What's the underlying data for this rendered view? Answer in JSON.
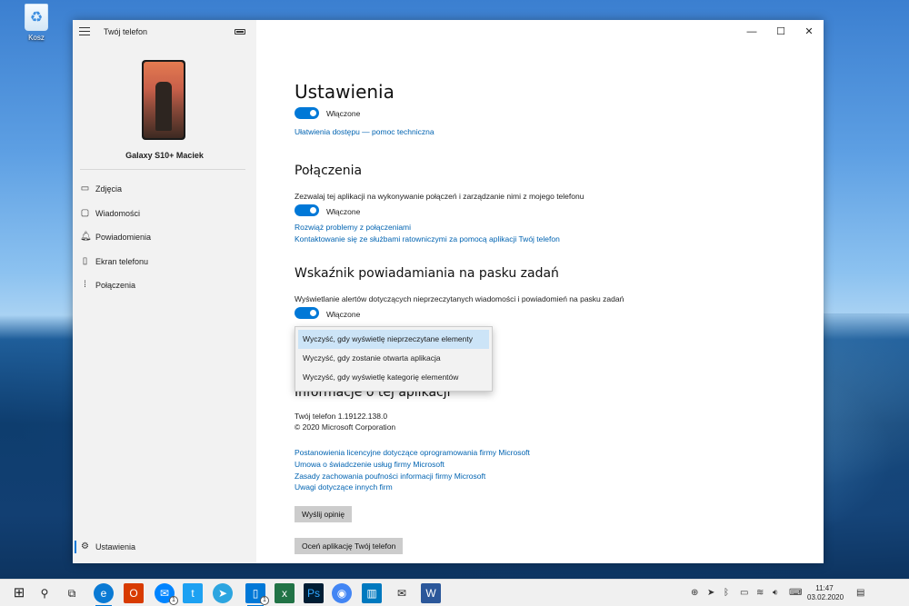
{
  "desktop": {
    "recycle_label": "Kosz"
  },
  "window": {
    "app_title": "Twój telefon",
    "minimize": "—",
    "maximize": "☐",
    "close": "✕"
  },
  "sidebar": {
    "device_name": "Galaxy S10+ Maciek",
    "items": [
      {
        "label": "Zdjęcia",
        "icon": "photos-icon"
      },
      {
        "label": "Wiadomości",
        "icon": "messages-icon"
      },
      {
        "label": "Powiadomienia",
        "icon": "bell-icon"
      },
      {
        "label": "Ekran telefonu",
        "icon": "phone-screen-icon"
      },
      {
        "label": "Połączenia",
        "icon": "dialpad-icon"
      }
    ],
    "settings_label": "Ustawienia"
  },
  "main": {
    "title": "Ustawienia",
    "toggle1_label": "Włączone",
    "accessibility_link": "Ułatwienia dostępu — pomoc techniczna",
    "calls": {
      "heading": "Połączenia",
      "description": "Zezwalaj tej aplikacji na wykonywanie połączeń i zarządzanie nimi z mojego telefonu",
      "toggle_label": "Włączone",
      "link1": "Rozwiąż problemy z połączeniami",
      "link2": "Kontaktowanie się ze służbami ratowniczymi za pomocą aplikacji Twój telefon"
    },
    "badge_section": {
      "heading": "Wskaźnik powiadamiania na pasku zadań",
      "description": "Wyświetlanie alertów dotyczących nieprzeczytanych wiadomości i powiadomień na pasku zadań",
      "toggle_label": "Włączone",
      "options": [
        "Wyczyść, gdy wyświetlę nieprzeczytane elementy",
        "Wyczyść, gdy zostanie otwarta aplikacja",
        "Wyczyść, gdy wyświetlę kategorię elementów"
      ],
      "selected_index": 0
    },
    "about": {
      "heading": "Informacje o tej aplikacji",
      "version": "Twój telefon 1.19122.138.0",
      "copyright": "© 2020 Microsoft Corporation",
      "links": [
        "Postanowienia licencyjne dotyczące oprogramowania firmy Microsoft",
        "Umowa o świadczenie usług firmy Microsoft",
        "Zasady zachowania poufności informacji firmy Microsoft",
        "Uwagi dotyczące innych firm"
      ],
      "feedback_button": "Wyślij opinię",
      "rate_button": "Oceń aplikację Twój telefon"
    }
  },
  "taskbar": {
    "time": "11:47",
    "date": "03.02.2020",
    "badge_count": "1",
    "apps": [
      {
        "icon": "windows-start-icon",
        "color": "#0078d7"
      },
      {
        "icon": "search-icon",
        "color": ""
      },
      {
        "icon": "task-view-icon",
        "color": ""
      },
      {
        "icon": "edge-icon",
        "color": "#0a7ad4"
      },
      {
        "icon": "office-icon",
        "color": "#d83b01"
      },
      {
        "icon": "messenger-icon",
        "color": "#0084ff"
      },
      {
        "icon": "twitter-icon",
        "color": "#1da1f2"
      },
      {
        "icon": "telegram-icon",
        "color": "#2ca5e0"
      },
      {
        "icon": "your-phone-icon",
        "color": "#0078d7"
      },
      {
        "icon": "excel-icon",
        "color": "#217346"
      },
      {
        "icon": "photoshop-icon",
        "color": "#001d34"
      },
      {
        "icon": "chrome-icon",
        "color": "#4285f4"
      },
      {
        "icon": "trello-icon",
        "color": "#0079bf"
      },
      {
        "icon": "mail-icon",
        "color": "#333333"
      },
      {
        "icon": "word-icon",
        "color": "#2b579a"
      }
    ]
  },
  "colors": {
    "accent": "#0078d7",
    "link": "#0063b1"
  }
}
